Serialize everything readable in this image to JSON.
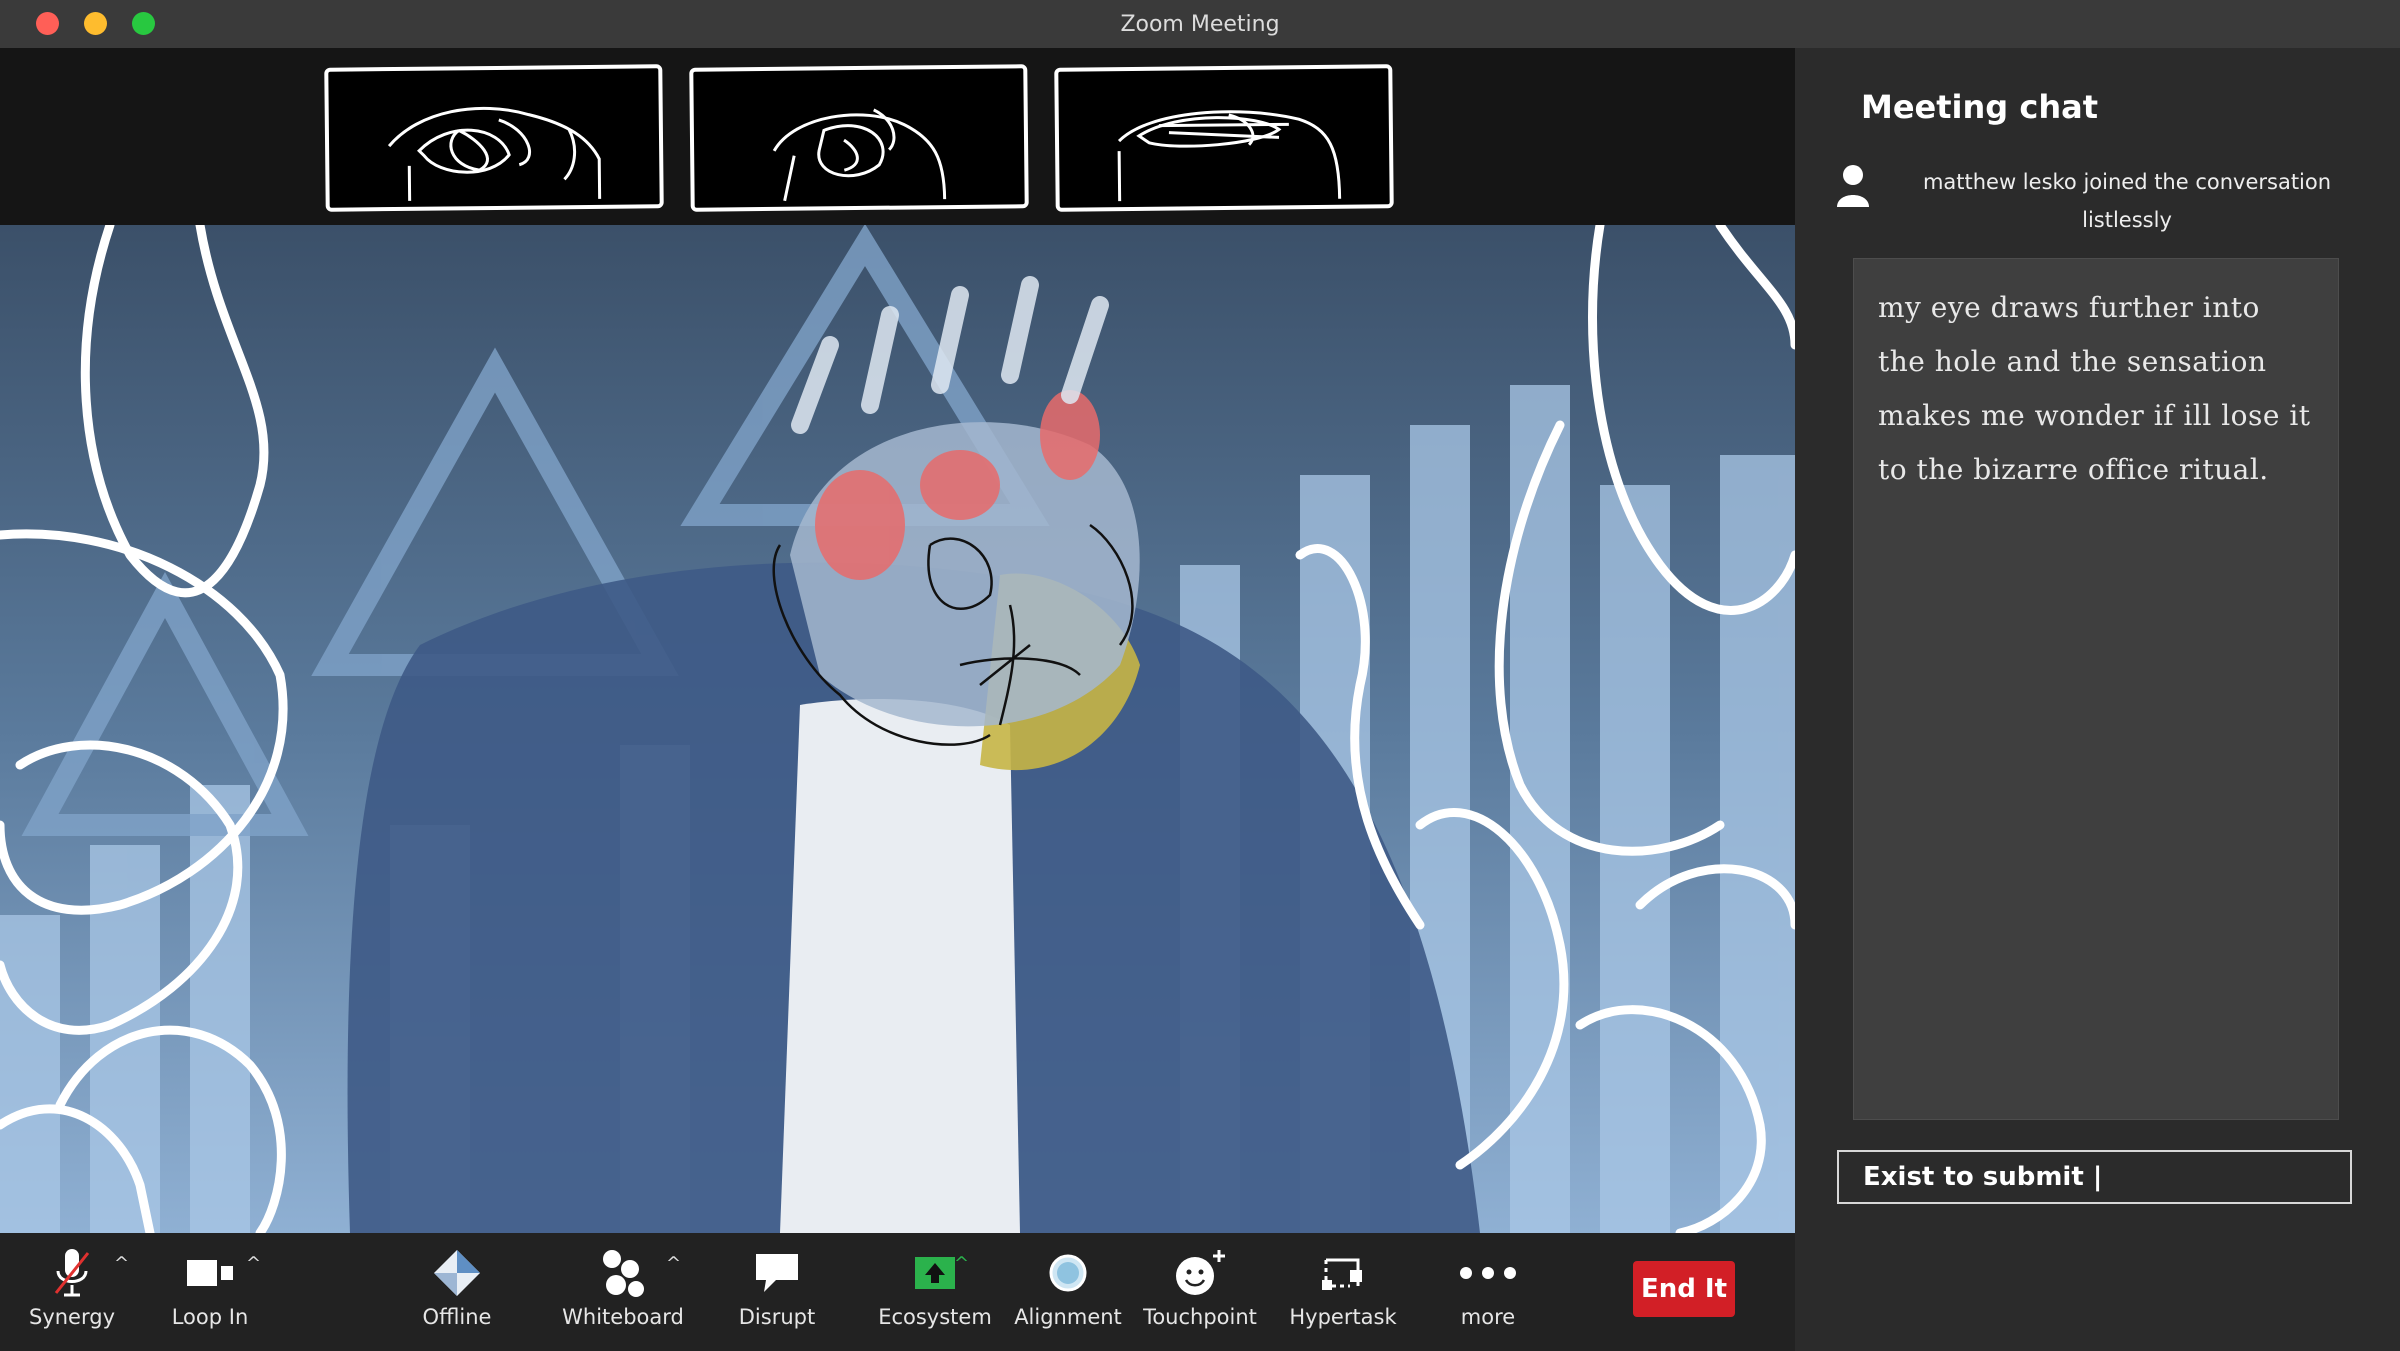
{
  "window": {
    "title": "Zoom Meeting"
  },
  "chat": {
    "title": "Meeting chat",
    "join_notice": "matthew lesko  joined the conversation listlessly",
    "message": "my eye draws further into the hole and the sensation makes me wonder if ill lose it to the bizarre office ritual.",
    "input_placeholder": "Exist to submit |"
  },
  "toolbar": {
    "synergy": "Synergy",
    "loop_in": "Loop In",
    "offline": "Offline",
    "whiteboard": "Whiteboard",
    "disrupt": "Disrupt",
    "ecosystem": "Ecosystem",
    "alignment": "Alignment",
    "touchpoint": "Touchpoint",
    "hypertask": "Hypertask",
    "more": "more",
    "end": "End It"
  },
  "colors": {
    "end_button": "#d21f26",
    "ecosystem_icon": "#2bb24c",
    "mute_slash": "#e0312f"
  },
  "icons": [
    "microphone-muted-icon",
    "video-camera-icon",
    "offline-diamond-icon",
    "whiteboard-people-icon",
    "speech-bubble-icon",
    "share-arrow-icon",
    "alignment-circle-icon",
    "smiley-plus-icon",
    "hypertask-icon",
    "ellipsis-icon",
    "person-icon"
  ]
}
